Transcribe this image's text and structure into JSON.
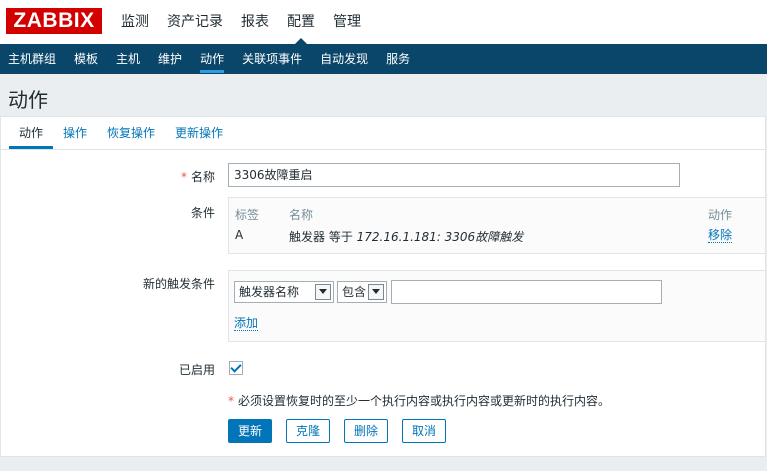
{
  "brand": {
    "logo": "ZABBIX",
    "color": "#d40000"
  },
  "main_menu": [
    {
      "label": "监测",
      "selected": false
    },
    {
      "label": "资产记录",
      "selected": false
    },
    {
      "label": "报表",
      "selected": false
    },
    {
      "label": "配置",
      "selected": true
    },
    {
      "label": "管理",
      "selected": false
    }
  ],
  "sub_menu": [
    {
      "label": "主机群组",
      "selected": false
    },
    {
      "label": "模板",
      "selected": false
    },
    {
      "label": "主机",
      "selected": false
    },
    {
      "label": "维护",
      "selected": false
    },
    {
      "label": "动作",
      "selected": true
    },
    {
      "label": "关联项事件",
      "selected": false
    },
    {
      "label": "自动发现",
      "selected": false
    },
    {
      "label": "服务",
      "selected": false
    }
  ],
  "page_title": "动作",
  "tabs": [
    {
      "label": "动作",
      "selected": true
    },
    {
      "label": "操作",
      "selected": false
    },
    {
      "label": "恢复操作",
      "selected": false
    },
    {
      "label": "更新操作",
      "selected": false
    }
  ],
  "form": {
    "required_mark": "*",
    "name_label": "名称",
    "name_value": "3306故障重启",
    "conditions_label": "条件",
    "conditions_table": {
      "headers": {
        "tag": "标签",
        "name": "名称",
        "action": "动作"
      },
      "rows": [
        {
          "tag": "A",
          "name_prefix": "触发器 等于 ",
          "name_value": "172.16.1.181: 3306故障触发",
          "action": "移除"
        }
      ]
    },
    "new_condition_label": "新的触发条件",
    "new_condition": {
      "type_select": "触发器名称",
      "operator_select": "包含",
      "value": "",
      "add_link": "添加"
    },
    "enabled_label": "已启用",
    "enabled": true,
    "note_mark": "*",
    "note": "必须设置恢复时的至少一个执行内容或执行内容或更新时的执行内容。"
  },
  "buttons": {
    "update": "更新",
    "clone": "克隆",
    "delete": "删除",
    "cancel": "取消"
  },
  "colors": {
    "nav_bg": "#0a466a",
    "link": "#0275b8",
    "required": "#e45959",
    "page_bg": "#ebeef0"
  }
}
